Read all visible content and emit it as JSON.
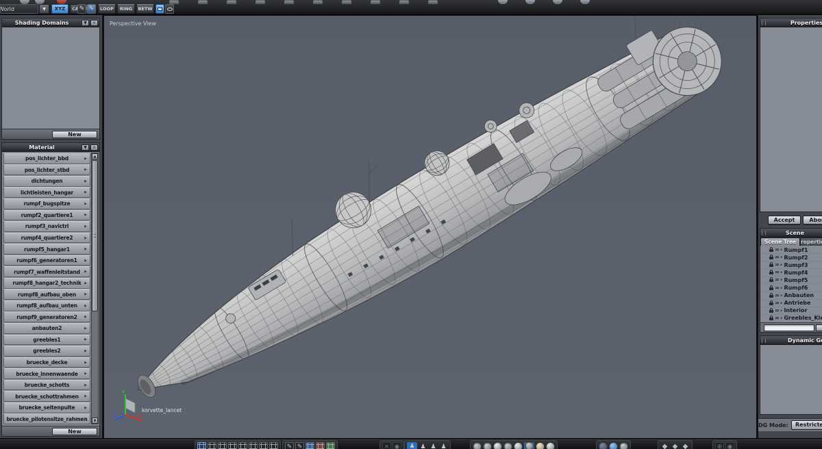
{
  "colors": {
    "accent_blue": "#4a8fd3",
    "panel_gray": "#868c96",
    "viewport_bg": "#5a606c",
    "toolbar_dark": "#1c1d1f",
    "button_light": "#d8dbe0",
    "axis_x_red": "#d93425",
    "axis_y_green": "#35c435",
    "axis_z_blue": "#3057d9"
  },
  "icons": {
    "dropdown": "▼",
    "close": "×",
    "up_arrow": "▲",
    "down_arrow": "▼",
    "item_arrow": "▶",
    "caret": "▸",
    "eye": "∞",
    "pen": "✎",
    "pawn": "♟",
    "diamond": "◆",
    "target": "◉",
    "plus_circle": "⊕"
  },
  "topbar": {
    "world_value": "World",
    "xyz_label": "XYZ",
    "camera_label": "CAMERA",
    "loop_label": "LOOP",
    "ring_label": "RING",
    "betw_label": "BETW"
  },
  "left": {
    "shading_domains": {
      "title": "Shading Domains",
      "new_button": "New"
    },
    "material": {
      "title": "Material",
      "new_button": "New",
      "items": [
        "pos_lichter_bbd",
        "pos_lichter_stbd",
        "dichtungen",
        "lichtleisten_hangar",
        "rumpf_bugspitze",
        "rumpf2_quartiere1",
        "rumpf3_navictrl",
        "rumpf4_quartiere2",
        "rumpf5_hangar1",
        "rumpf6_generatoren1",
        "rumpf7_waffenleitstand",
        "rumpf8_hangar2_technik",
        "rumpf8_aufbau_oben",
        "rumpf8_aufbau_unten",
        "rumpf9_generatoren2",
        "anbauten2",
        "greebles1",
        "greebles2",
        "bruecke_decke",
        "bruecke_innenwaende",
        "bruecke_schotts",
        "bruecke_schottrahmen",
        "bruecke_seitenpulte",
        "bruecke_pilotensitze_rahmen"
      ]
    }
  },
  "viewport": {
    "view_label": "Perspective View",
    "model_label": "korvette_lancet",
    "axes": {
      "x": "X",
      "y": "Y",
      "z": "Z"
    }
  },
  "right": {
    "properties": {
      "title": "Properties"
    },
    "accept_button": "Accept",
    "abort_button": "Abort",
    "scene": {
      "title": "Scene",
      "tabs": [
        "Scene Tree",
        "Properties"
      ],
      "tree": [
        "Rumpf1",
        "Rumpf2",
        "Rumpf3",
        "Rumpf4",
        "Rumpf5",
        "Rumpf6",
        "Anbauten",
        "Antriebe",
        "Interior",
        "Greebles_Kle"
      ],
      "search_button": "S"
    },
    "dynamic_geometry": {
      "title": "Dynamic Geometry"
    },
    "dg_mode": {
      "label": "DG Mode:",
      "value": "Restricted"
    }
  }
}
